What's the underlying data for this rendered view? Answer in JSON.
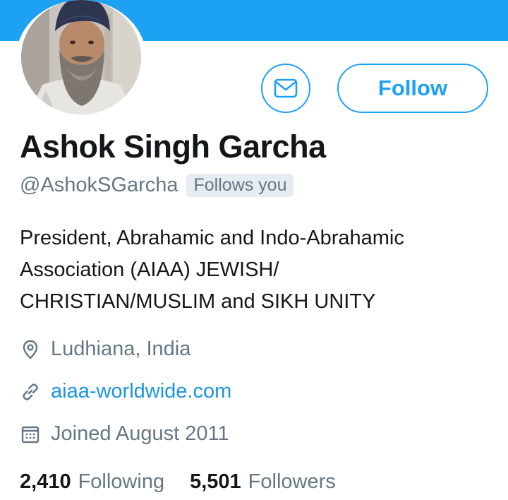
{
  "theme": {
    "accent": "#1da1f2",
    "link": "#1b95e0",
    "text_primary": "#14171a",
    "text_secondary": "#657786",
    "badge_bg": "#e6ecf0"
  },
  "profile": {
    "avatar_icon": "profile-photo",
    "name": "Ashok Singh Garcha",
    "handle": "@AshokSGarcha",
    "follows_you": "Follows you",
    "bio": "President, Abrahamic and Indo-Abrahamic\nAssociation (AIAA)                JEWISH/\nCHRISTIAN/MUSLIM and SIKH UNITY"
  },
  "actions": {
    "message_icon": "envelope-icon",
    "follow_label": "Follow"
  },
  "details": {
    "location": {
      "icon": "location-pin-icon",
      "text": "Ludhiana, India"
    },
    "website": {
      "icon": "link-icon",
      "text": "aiaa-worldwide.com"
    },
    "joined": {
      "icon": "calendar-icon",
      "text": "Joined August 2011"
    }
  },
  "stats": {
    "following": {
      "count": "2,410",
      "label": "Following"
    },
    "followers": {
      "count": "5,501",
      "label": "Followers"
    }
  }
}
